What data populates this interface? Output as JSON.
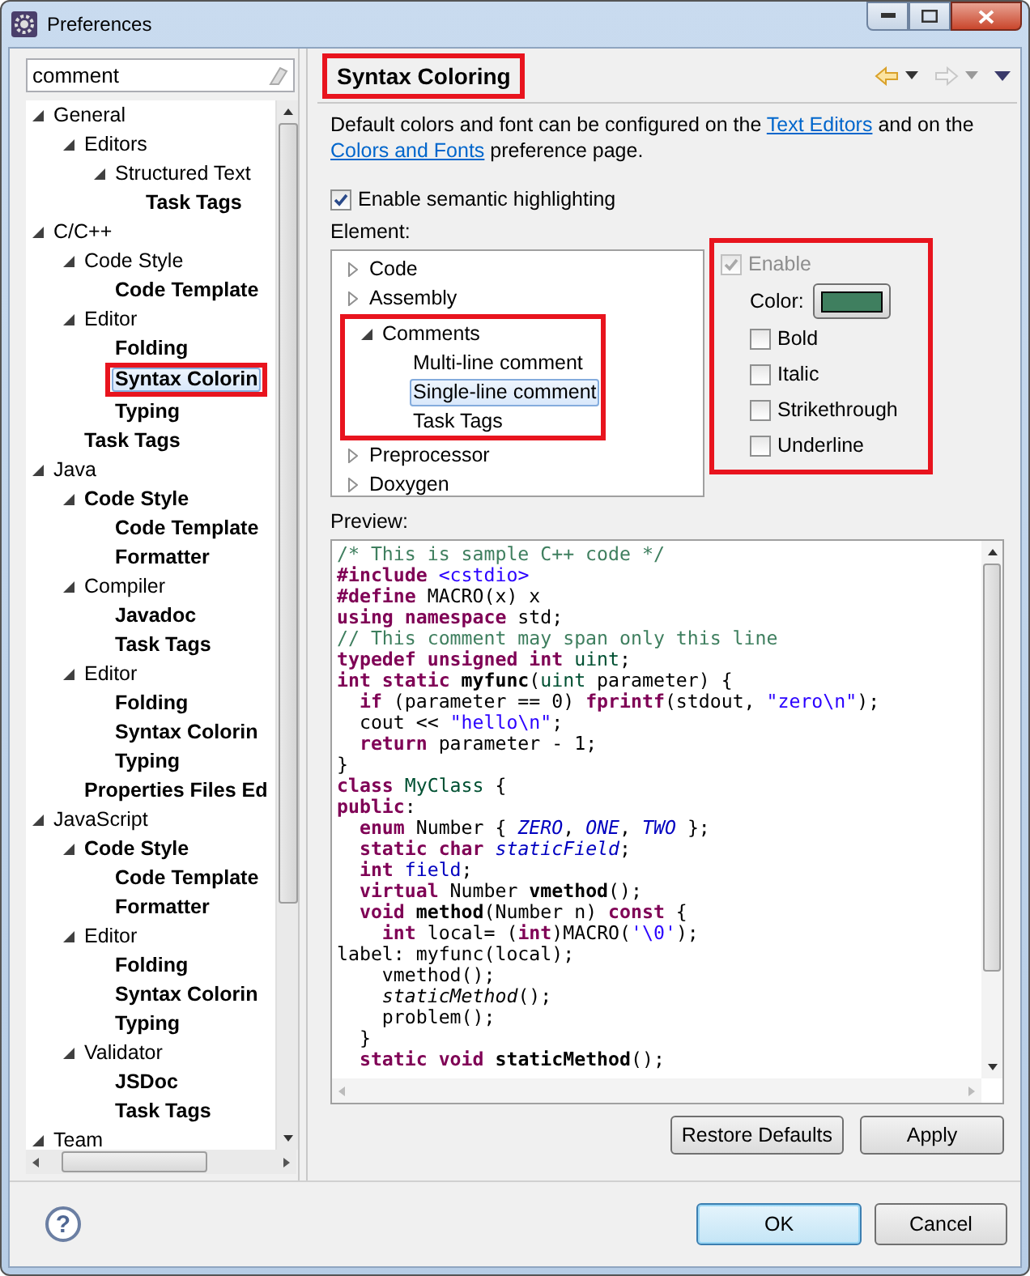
{
  "window": {
    "title": "Preferences"
  },
  "sidebar": {
    "filter": {
      "value": "comment"
    },
    "items": [
      {
        "label": "General",
        "match": false,
        "expanded": true,
        "selected": false,
        "children": [
          {
            "label": "Editors",
            "match": false,
            "expanded": true,
            "selected": false,
            "children": [
              {
                "label": "Structured Text",
                "match": false,
                "expanded": true,
                "selected": false,
                "children": [
                  {
                    "label": "Task Tags",
                    "match": true,
                    "selected": false
                  }
                ]
              }
            ]
          }
        ]
      },
      {
        "label": "C/C++",
        "match": false,
        "expanded": true,
        "selected": false,
        "children": [
          {
            "label": "Code Style",
            "match": false,
            "expanded": true,
            "selected": false,
            "children": [
              {
                "label": "Code Template",
                "match": true,
                "selected": false
              }
            ]
          },
          {
            "label": "Editor",
            "match": false,
            "expanded": true,
            "selected": false,
            "children": [
              {
                "label": "Folding",
                "match": true,
                "selected": false
              },
              {
                "label": "Syntax Colorin",
                "match": true,
                "selected": true,
                "highlighted": true
              },
              {
                "label": "Typing",
                "match": true,
                "selected": false
              }
            ]
          },
          {
            "label": "Task Tags",
            "match": true,
            "selected": false
          }
        ]
      },
      {
        "label": "Java",
        "match": false,
        "expanded": true,
        "selected": false,
        "children": [
          {
            "label": "Code Style",
            "match": true,
            "expanded": true,
            "selected": false,
            "children": [
              {
                "label": "Code Template",
                "match": true,
                "selected": false
              },
              {
                "label": "Formatter",
                "match": true,
                "selected": false
              }
            ]
          },
          {
            "label": "Compiler",
            "match": false,
            "expanded": true,
            "selected": false,
            "children": [
              {
                "label": "Javadoc",
                "match": true,
                "selected": false
              },
              {
                "label": "Task Tags",
                "match": true,
                "selected": false
              }
            ]
          },
          {
            "label": "Editor",
            "match": false,
            "expanded": true,
            "selected": false,
            "children": [
              {
                "label": "Folding",
                "match": true,
                "selected": false
              },
              {
                "label": "Syntax Colorin",
                "match": true,
                "selected": false
              },
              {
                "label": "Typing",
                "match": true,
                "selected": false
              }
            ]
          },
          {
            "label": "Properties Files Ed",
            "match": true,
            "selected": false
          }
        ]
      },
      {
        "label": "JavaScript",
        "match": false,
        "expanded": true,
        "selected": false,
        "children": [
          {
            "label": "Code Style",
            "match": true,
            "expanded": true,
            "selected": false,
            "children": [
              {
                "label": "Code Template",
                "match": true,
                "selected": false
              },
              {
                "label": "Formatter",
                "match": true,
                "selected": false
              }
            ]
          },
          {
            "label": "Editor",
            "match": false,
            "expanded": true,
            "selected": false,
            "children": [
              {
                "label": "Folding",
                "match": true,
                "selected": false
              },
              {
                "label": "Syntax Colorin",
                "match": true,
                "selected": false
              },
              {
                "label": "Typing",
                "match": true,
                "selected": false
              }
            ]
          },
          {
            "label": "Validator",
            "match": false,
            "expanded": true,
            "selected": false,
            "children": [
              {
                "label": "JSDoc",
                "match": true,
                "selected": false
              },
              {
                "label": "Task Tags",
                "match": true,
                "selected": false
              }
            ]
          }
        ]
      },
      {
        "label": "Team",
        "match": false,
        "expanded": true,
        "selected": false
      }
    ]
  },
  "page": {
    "title": "Syntax Coloring",
    "highlighted": true,
    "description": [
      {
        "kind": "text",
        "text": "Default colors and font can be configured on the "
      },
      {
        "kind": "link",
        "text": "Text Editors"
      },
      {
        "kind": "text",
        "text": " and on the "
      },
      {
        "kind": "link",
        "text": "Colors and Fonts"
      },
      {
        "kind": "text",
        "text": " preference page."
      }
    ],
    "semantic_highlighting": {
      "label": "Enable semantic highlighting",
      "checked": true
    },
    "element_label": "Element:",
    "elements": [
      {
        "label": "Code",
        "expanded": false,
        "selected": false
      },
      {
        "label": "Assembly",
        "expanded": false,
        "selected": false
      },
      {
        "label": "Comments",
        "expanded": true,
        "selected": false,
        "highlighted": true,
        "children": [
          {
            "label": "Multi-line comment",
            "selected": false
          },
          {
            "label": "Single-line comment",
            "selected": true
          },
          {
            "label": "Task Tags",
            "selected": false
          }
        ]
      },
      {
        "label": "Preprocessor",
        "expanded": false,
        "selected": false
      },
      {
        "label": "Doxygen",
        "expanded": false,
        "selected": false
      }
    ],
    "options": {
      "highlighted": true,
      "enable": {
        "label": "Enable",
        "checked": true,
        "disabled": true
      },
      "color_label": "Color:",
      "color": "#3f7f5f",
      "styles": [
        {
          "label": "Bold",
          "checked": false
        },
        {
          "label": "Italic",
          "checked": false
        },
        {
          "label": "Strikethrough",
          "checked": false
        },
        {
          "label": "Underline",
          "checked": false
        }
      ]
    },
    "preview_label": "Preview:",
    "preview": [
      {
        "tokens": [
          {
            "kind": "comment",
            "text": "/* This is sample C++ code */"
          }
        ]
      },
      {
        "tokens": [
          {
            "kind": "keyword",
            "text": "#include "
          },
          {
            "kind": "string",
            "text": "<cstdio>"
          }
        ]
      },
      {
        "tokens": [
          {
            "kind": "keyword",
            "text": "#define"
          },
          {
            "kind": "plain",
            "text": " MACRO(x) x"
          }
        ]
      },
      {
        "tokens": [
          {
            "kind": "keyword",
            "text": "using namespace"
          },
          {
            "kind": "plain",
            "text": " std;"
          }
        ]
      },
      {
        "tokens": [
          {
            "kind": "comment",
            "text": "// This comment may span only this line"
          }
        ]
      },
      {
        "tokens": [
          {
            "kind": "keyword",
            "text": "typedef unsigned int "
          },
          {
            "kind": "type",
            "text": "uint"
          },
          {
            "kind": "plain",
            "text": ";"
          }
        ]
      },
      {
        "tokens": [
          {
            "kind": "keyword",
            "text": "int static "
          },
          {
            "kind": "method",
            "text": "myfunc"
          },
          {
            "kind": "plain",
            "text": "("
          },
          {
            "kind": "type",
            "text": "uint"
          },
          {
            "kind": "plain",
            "text": " parameter) {"
          }
        ]
      },
      {
        "tokens": [
          {
            "kind": "keyword",
            "text": "  if"
          },
          {
            "kind": "plain",
            "text": " (parameter == 0) "
          },
          {
            "kind": "keyword",
            "text": "fprintf"
          },
          {
            "kind": "plain",
            "text": "(stdout, "
          },
          {
            "kind": "string",
            "text": "\"zero\\n\""
          },
          {
            "kind": "plain",
            "text": ");"
          }
        ]
      },
      {
        "tokens": [
          {
            "kind": "plain",
            "text": "  cout << "
          },
          {
            "kind": "string",
            "text": "\"hello\\n\""
          },
          {
            "kind": "plain",
            "text": ";"
          }
        ]
      },
      {
        "tokens": [
          {
            "kind": "keyword",
            "text": "  return"
          },
          {
            "kind": "plain",
            "text": " parameter - 1;"
          }
        ]
      },
      {
        "tokens": [
          {
            "kind": "plain",
            "text": "}"
          }
        ]
      },
      {
        "tokens": [
          {
            "kind": "keyword",
            "text": "class "
          },
          {
            "kind": "type",
            "text": "MyClass"
          },
          {
            "kind": "plain",
            "text": " {"
          }
        ]
      },
      {
        "tokens": [
          {
            "kind": "keyword",
            "text": "public"
          },
          {
            "kind": "plain",
            "text": ":"
          }
        ]
      },
      {
        "tokens": [
          {
            "kind": "keyword",
            "text": "  enum"
          },
          {
            "kind": "plain",
            "text": " Number { "
          },
          {
            "kind": "constant",
            "text": "ZERO"
          },
          {
            "kind": "plain",
            "text": ", "
          },
          {
            "kind": "constant",
            "text": "ONE"
          },
          {
            "kind": "plain",
            "text": ", "
          },
          {
            "kind": "constant",
            "text": "TWO"
          },
          {
            "kind": "plain",
            "text": " };"
          }
        ]
      },
      {
        "tokens": [
          {
            "kind": "keyword",
            "text": "  static char "
          },
          {
            "kind": "constant",
            "text": "staticField"
          },
          {
            "kind": "plain",
            "text": ";"
          }
        ]
      },
      {
        "tokens": [
          {
            "kind": "keyword",
            "text": "  int "
          },
          {
            "kind": "field",
            "text": "field"
          },
          {
            "kind": "plain",
            "text": ";"
          }
        ]
      },
      {
        "tokens": [
          {
            "kind": "keyword",
            "text": "  virtual"
          },
          {
            "kind": "plain",
            "text": " Number "
          },
          {
            "kind": "method",
            "text": "vmethod"
          },
          {
            "kind": "plain",
            "text": "();"
          }
        ]
      },
      {
        "tokens": [
          {
            "kind": "keyword",
            "text": "  void "
          },
          {
            "kind": "method",
            "text": "method"
          },
          {
            "kind": "plain",
            "text": "(Number n) "
          },
          {
            "kind": "keyword",
            "text": "const"
          },
          {
            "kind": "plain",
            "text": " {"
          }
        ]
      },
      {
        "tokens": [
          {
            "kind": "keyword",
            "text": "    int"
          },
          {
            "kind": "plain",
            "text": " local= ("
          },
          {
            "kind": "keyword",
            "text": "int"
          },
          {
            "kind": "plain",
            "text": ")MACRO("
          },
          {
            "kind": "string",
            "text": "'\\0'"
          },
          {
            "kind": "plain",
            "text": ");"
          }
        ]
      },
      {
        "tokens": [
          {
            "kind": "plain",
            "text": "label: myfunc(local);"
          }
        ]
      },
      {
        "tokens": [
          {
            "kind": "plain",
            "text": "    vmethod();"
          }
        ]
      },
      {
        "tokens": [
          {
            "kind": "static-method",
            "text": "    staticMethod"
          },
          {
            "kind": "plain",
            "text": "();"
          }
        ]
      },
      {
        "tokens": [
          {
            "kind": "plain",
            "text": "    problem();"
          }
        ]
      },
      {
        "tokens": [
          {
            "kind": "plain",
            "text": "  }"
          }
        ]
      },
      {
        "tokens": [
          {
            "kind": "keyword",
            "text": "  static void "
          },
          {
            "kind": "method",
            "text": "staticMethod"
          },
          {
            "kind": "plain",
            "text": "();"
          }
        ]
      }
    ],
    "buttons": [
      "Restore Defaults",
      "Apply"
    ]
  },
  "help_button": "?",
  "dialog_buttons": [
    {
      "label": "OK",
      "default": true
    },
    {
      "label": "Cancel",
      "default": false
    }
  ]
}
